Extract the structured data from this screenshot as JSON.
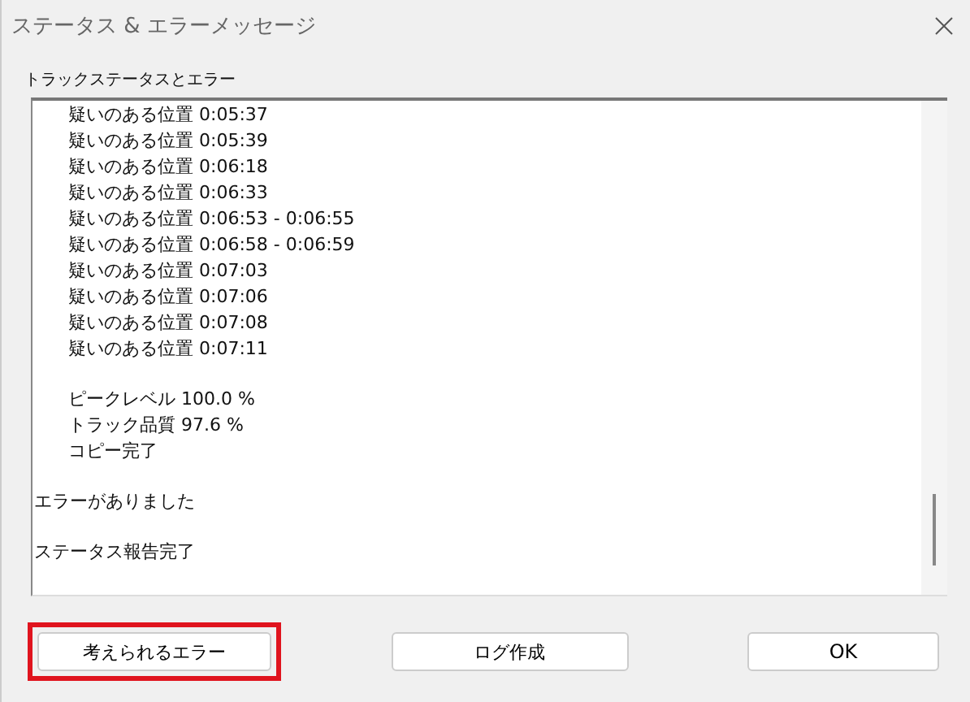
{
  "window": {
    "title": "ステータス & エラーメッセージ"
  },
  "group": {
    "label": "トラックステータスとエラー"
  },
  "log_blocks": [
    {
      "kind": "item",
      "lines": [
        "疑いのある位置 0:05:37",
        "疑いのある位置 0:05:39",
        "疑いのある位置 0:06:18",
        "疑いのある位置 0:06:33",
        "疑いのある位置 0:06:53 - 0:06:55",
        "疑いのある位置 0:06:58 - 0:06:59",
        "疑いのある位置 0:07:03",
        "疑いのある位置 0:07:06",
        "疑いのある位置 0:07:08",
        "疑いのある位置 0:07:11"
      ]
    },
    {
      "kind": "item",
      "lines": [
        "ピークレベル 100.0 %",
        "トラック品質 97.6 %",
        "コピー完了"
      ]
    },
    {
      "kind": "message",
      "lines": [
        "エラーがありました"
      ]
    },
    {
      "kind": "message",
      "lines": [
        "ステータス報告完了"
      ]
    }
  ],
  "buttons": [
    {
      "label": "考えられるエラー",
      "highlighted": true
    },
    {
      "label": "ログ作成",
      "highlighted": false
    },
    {
      "label": "OK",
      "highlighted": false
    }
  ]
}
